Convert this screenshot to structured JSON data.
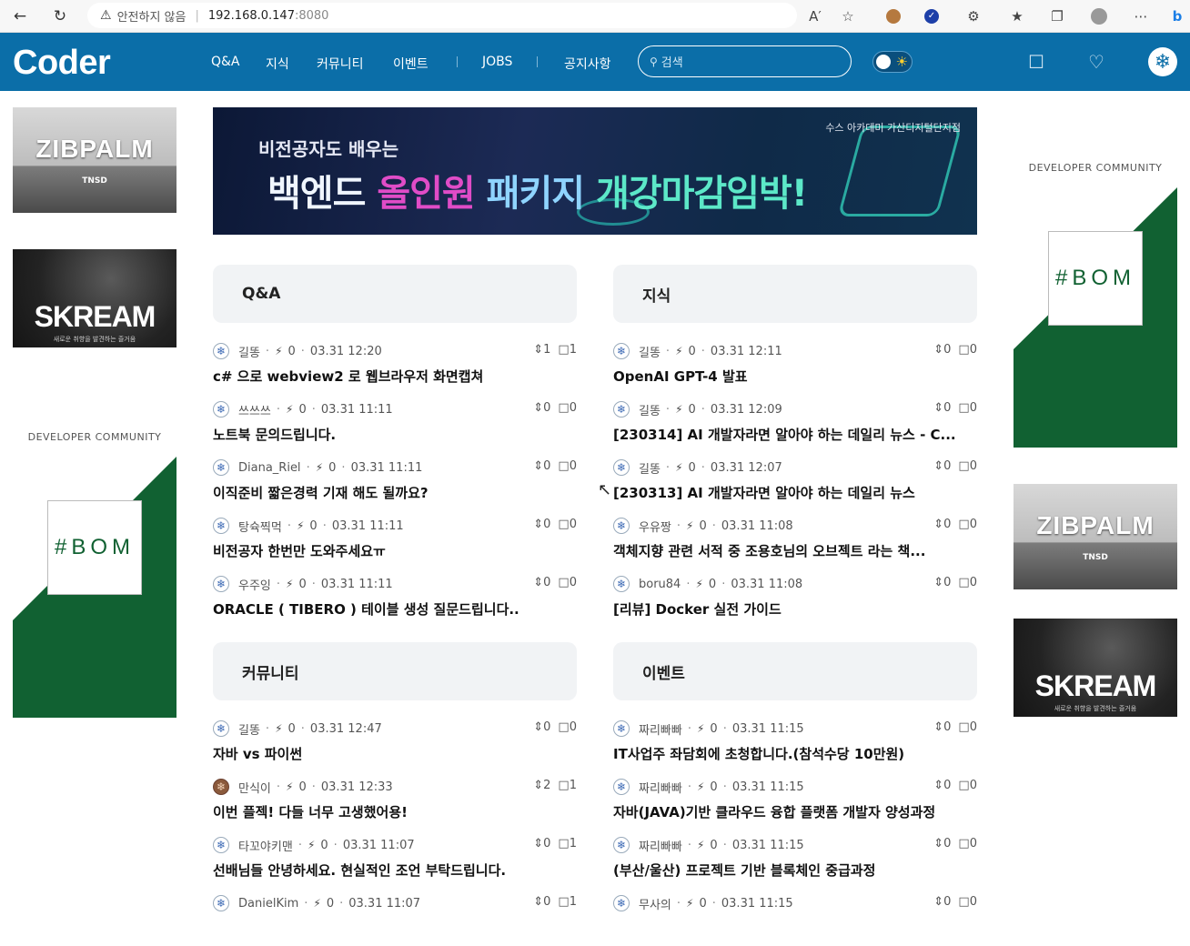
{
  "browser": {
    "warning_text": "안전하지 않음",
    "host": "192.168.0.147",
    "port": ":8080",
    "icons": [
      "back-icon",
      "refresh-icon",
      "home-icon",
      "read-aloud-icon",
      "favorite-icon",
      "cookie-extension-icon",
      "shield-extension-icon",
      "puzzle-icon",
      "favorites-list-icon",
      "collections-icon",
      "profile-icon",
      "more-icon",
      "bing-icon"
    ]
  },
  "nav": {
    "logo": "Coder",
    "menu": [
      "Q&A",
      "지식",
      "커뮤니티",
      "이벤트",
      "JOBS",
      "공지사항"
    ],
    "search_placeholder": "검색",
    "color": "#0b6ea8"
  },
  "ads": {
    "zibpalm": {
      "title": "ZIBPALM",
      "sub": "TNSD"
    },
    "skream": {
      "title": "SKREAM",
      "sub": "새로운 취향을 발견하는 즐거움"
    },
    "bom": {
      "caption": "DEVELOPER COMMUNITY",
      "logo": "#BOM"
    }
  },
  "banner": {
    "tag": "수스 아카데미 가산디지털단지점",
    "subtitle": "비전공자도 배우는",
    "w1": "백엔드 ",
    "w2": "올인원 ",
    "w3": "패키지 ",
    "w4": "개강마감임박!"
  },
  "sections": [
    {
      "title": "Q&A",
      "posts": [
        {
          "user": "길똥",
          "score": "0",
          "time": "03.31 12:20",
          "votes": "1",
          "comments": "1",
          "title": "c# 으로 webview2 로 웹브라우저 화면캡쳐"
        },
        {
          "user": "쓰쓰쓰",
          "score": "0",
          "time": "03.31 11:11",
          "votes": "0",
          "comments": "0",
          "title": "노트북 문의드립니다."
        },
        {
          "user": "Diana_Riel",
          "score": "0",
          "time": "03.31 11:11",
          "votes": "0",
          "comments": "0",
          "title": "이직준비 짧은경력 기재 해도 될까요?"
        },
        {
          "user": "탕슉찍먹",
          "score": "0",
          "time": "03.31 11:11",
          "votes": "0",
          "comments": "0",
          "title": "비전공자 한번만 도와주세요ㅠ"
        },
        {
          "user": "우주잉",
          "score": "0",
          "time": "03.31 11:11",
          "votes": "0",
          "comments": "0",
          "title": "ORACLE ( TIBERO ) 테이블 생성 질문드립니다.."
        }
      ]
    },
    {
      "title": "지식",
      "posts": [
        {
          "user": "길똥",
          "score": "0",
          "time": "03.31 12:11",
          "votes": "0",
          "comments": "0",
          "title": "OpenAI GPT-4 발표"
        },
        {
          "user": "길똥",
          "score": "0",
          "time": "03.31 12:09",
          "votes": "0",
          "comments": "0",
          "title": "[230314] AI 개발자라면 알아야 하는 데일리 뉴스 - C..."
        },
        {
          "user": "길똥",
          "score": "0",
          "time": "03.31 12:07",
          "votes": "0",
          "comments": "0",
          "title": "[230313] AI 개발자라면 알아야 하는 데일리 뉴스"
        },
        {
          "user": "우유짱",
          "score": "0",
          "time": "03.31 11:08",
          "votes": "0",
          "comments": "0",
          "title": "객체지향 관련 서적 중 조용호님의 오브젝트 라는 책..."
        },
        {
          "user": "boru84",
          "score": "0",
          "time": "03.31 11:08",
          "votes": "0",
          "comments": "0",
          "title": "[리뷰] Docker 실전 가이드"
        }
      ]
    },
    {
      "title": "커뮤니티",
      "posts": [
        {
          "user": "길똥",
          "score": "0",
          "time": "03.31 12:47",
          "votes": "0",
          "comments": "0",
          "title": "자바 vs 파이썬"
        },
        {
          "user": "만식이",
          "score": "0",
          "time": "03.31 12:33",
          "votes": "2",
          "comments": "1",
          "title": "이번 플젝! 다들 너무 고생했어용!"
        },
        {
          "user": "타꼬야키맨",
          "score": "0",
          "time": "03.31 11:07",
          "votes": "0",
          "comments": "1",
          "title": "선배님들 안녕하세요. 현실적인 조언 부탁드립니다."
        },
        {
          "user": "DanielKim",
          "score": "0",
          "time": "03.31 11:07",
          "votes": "0",
          "comments": "1",
          "title": ""
        }
      ]
    },
    {
      "title": "이벤트",
      "posts": [
        {
          "user": "짜리빠빠",
          "score": "0",
          "time": "03.31 11:15",
          "votes": "0",
          "comments": "0",
          "title": "IT사업주 좌담회에 초청합니다.(참석수당 10만원)"
        },
        {
          "user": "짜리빠빠",
          "score": "0",
          "time": "03.31 11:15",
          "votes": "0",
          "comments": "0",
          "title": "자바(JAVA)기반 클라우드 융합 플랫폼 개발자 양성과정"
        },
        {
          "user": "짜리빠빠",
          "score": "0",
          "time": "03.31 11:15",
          "votes": "0",
          "comments": "0",
          "title": "(부산/울산) 프로젝트 기반 블록체인 중급과정"
        },
        {
          "user": "무사의",
          "score": "0",
          "time": "03.31 11:15",
          "votes": "0",
          "comments": "0",
          "title": ""
        }
      ]
    }
  ]
}
